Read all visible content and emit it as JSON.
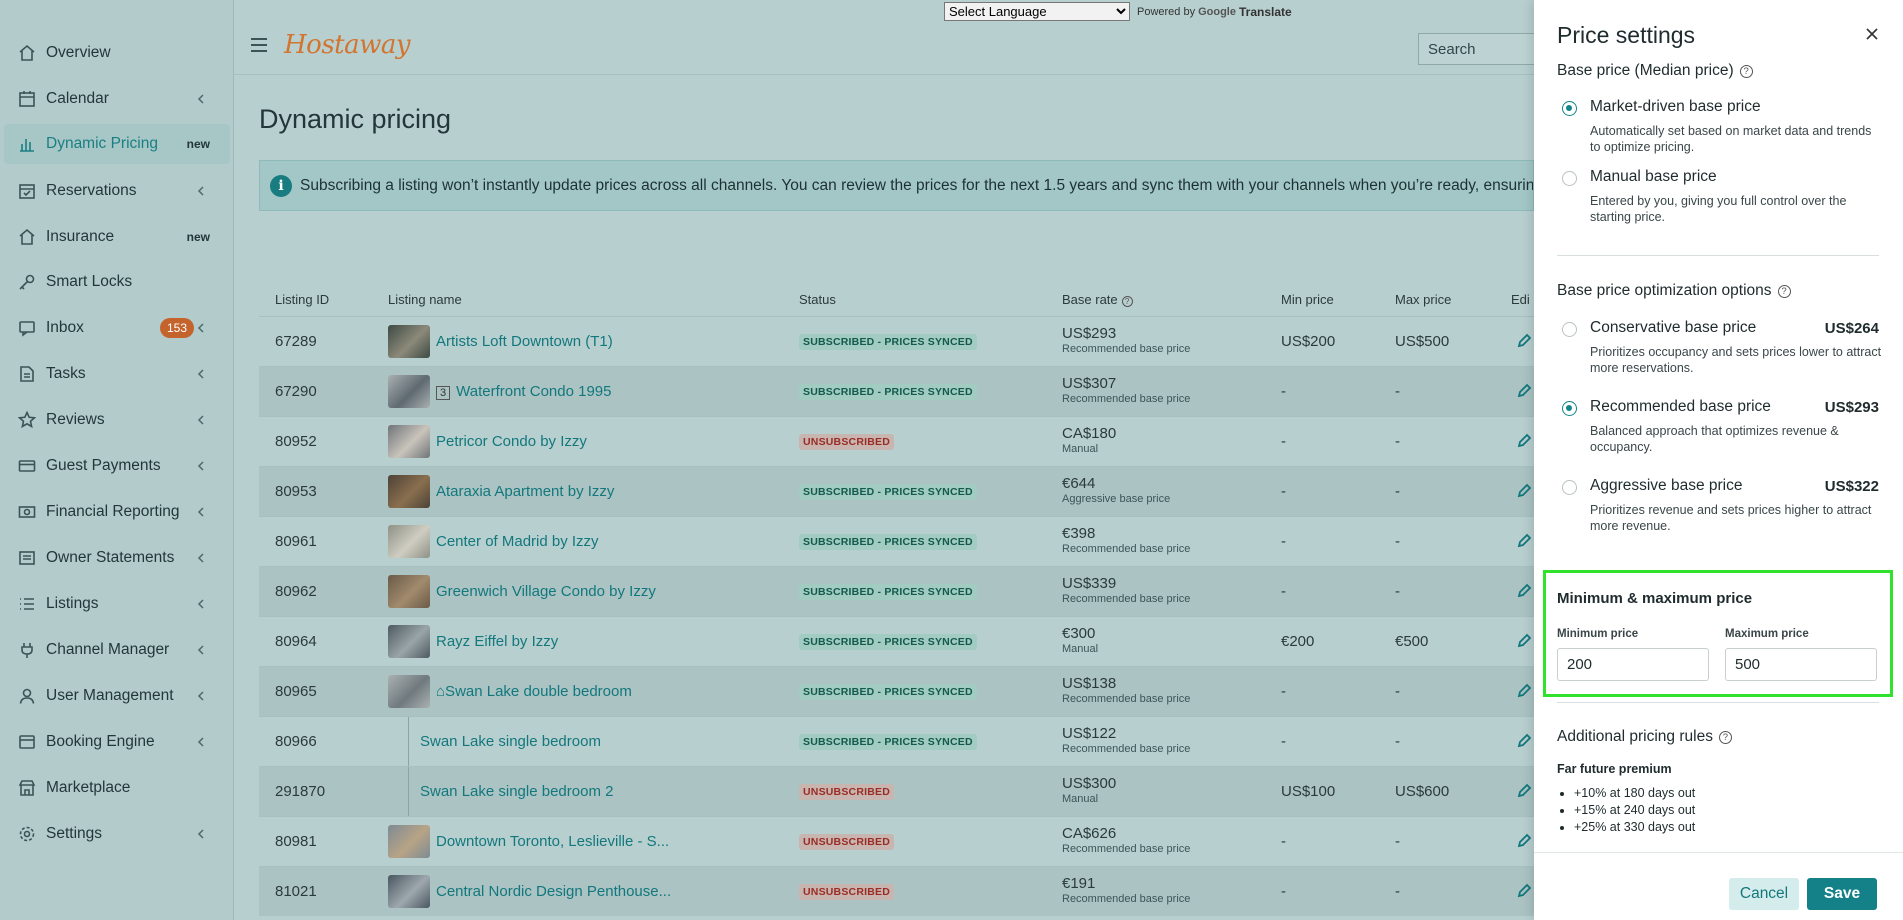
{
  "translate": {
    "select_value": "Select Language",
    "powered_by": "Powered by",
    "google": "Google",
    "translate": "Translate"
  },
  "header": {
    "logo": "Hostaway",
    "search_placeholder": "Search"
  },
  "sidebar": {
    "items": [
      {
        "label": "Overview",
        "icon": "home-icon"
      },
      {
        "label": "Calendar",
        "icon": "calendar-icon"
      },
      {
        "label": "Dynamic Pricing",
        "icon": "bar-chart-icon",
        "badge": "new"
      },
      {
        "label": "Reservations",
        "icon": "calendar-check-icon"
      },
      {
        "label": "Insurance",
        "icon": "home-shield-icon",
        "badge": "new"
      },
      {
        "label": "Smart Locks",
        "icon": "key-icon"
      },
      {
        "label": "Inbox",
        "icon": "chat-icon",
        "count": "153"
      },
      {
        "label": "Tasks",
        "icon": "tasks-icon"
      },
      {
        "label": "Reviews",
        "icon": "star-icon"
      },
      {
        "label": "Guest Payments",
        "icon": "credit-card-icon"
      },
      {
        "label": "Financial Reporting",
        "icon": "money-icon"
      },
      {
        "label": "Owner Statements",
        "icon": "statement-icon"
      },
      {
        "label": "Listings",
        "icon": "list-icon"
      },
      {
        "label": "Channel Manager",
        "icon": "plug-icon"
      },
      {
        "label": "User Management",
        "icon": "user-icon"
      },
      {
        "label": "Booking Engine",
        "icon": "globe-icon"
      },
      {
        "label": "Marketplace",
        "icon": "store-icon"
      },
      {
        "label": "Settings",
        "icon": "gear-icon"
      }
    ]
  },
  "main": {
    "title": "Dynamic pricing",
    "banner": "Subscribing a listing won’t instantly update prices across all channels. You can review the prices for the next 1.5 years and sync them with your channels when you’re ready, ensuring everythin",
    "columns": {
      "listing_id": "Listing ID",
      "listing_name": "Listing name",
      "status": "Status",
      "base_rate": "Base rate",
      "min_price": "Min price",
      "max_price": "Max price",
      "edit": "Edi"
    },
    "rows": [
      {
        "id": "67289",
        "name": "Artists Loft Downtown (T1)",
        "status": "SUBSCRIBED - PRICES SYNCED",
        "rate": "US$293",
        "rate_type": "Recommended base price",
        "min": "US$200",
        "max": "US$500"
      },
      {
        "id": "67290",
        "badge": "3",
        "name": "Waterfront Condo 1995",
        "status": "SUBSCRIBED - PRICES SYNCED",
        "rate": "US$307",
        "rate_type": "Recommended base price",
        "min": "-",
        "max": "-"
      },
      {
        "id": "80952",
        "name": "Petricor Condo by Izzy",
        "status": "UNSUBSCRIBED",
        "rate": "CA$180",
        "rate_type": "Manual",
        "min": "-",
        "max": "-"
      },
      {
        "id": "80953",
        "name": "Ataraxia Apartment by Izzy",
        "status": "SUBSCRIBED - PRICES SYNCED",
        "rate": "€644",
        "rate_type": "Aggressive base price",
        "min": "-",
        "max": "-"
      },
      {
        "id": "80961",
        "name": "Center of Madrid by Izzy",
        "status": "SUBSCRIBED - PRICES SYNCED",
        "rate": "€398",
        "rate_type": "Recommended base price",
        "min": "-",
        "max": "-"
      },
      {
        "id": "80962",
        "name": "Greenwich Village Condo by Izzy",
        "status": "SUBSCRIBED - PRICES SYNCED",
        "rate": "US$339",
        "rate_type": "Recommended base price",
        "min": "-",
        "max": "-"
      },
      {
        "id": "80964",
        "name": "Rayz Eiffel by Izzy",
        "status": "SUBSCRIBED - PRICES SYNCED",
        "rate": "€300",
        "rate_type": "Manual",
        "min": "€200",
        "max": "€500"
      },
      {
        "id": "80965",
        "name": "⌂Swan Lake double bedroom",
        "status": "SUBSCRIBED - PRICES SYNCED",
        "rate": "US$138",
        "rate_type": "Recommended base price",
        "min": "-",
        "max": "-"
      },
      {
        "id": "80966",
        "name": "Swan Lake single bedroom",
        "status": "SUBSCRIBED - PRICES SYNCED",
        "rate": "US$122",
        "rate_type": "Recommended base price",
        "min": "-",
        "max": "-"
      },
      {
        "id": "291870",
        "name": "Swan Lake single bedroom 2",
        "status": "UNSUBSCRIBED",
        "rate": "US$300",
        "rate_type": "Manual",
        "min": "US$100",
        "max": "US$600"
      },
      {
        "id": "80981",
        "name": "Downtown Toronto, Leslieville - S...",
        "status": "UNSUBSCRIBED",
        "rate": "CA$626",
        "rate_type": "Recommended base price",
        "min": "-",
        "max": "-"
      },
      {
        "id": "81021",
        "name": "Central Nordic Design Penthouse...",
        "status": "UNSUBSCRIBED",
        "rate": "€191",
        "rate_type": "Recommended base price",
        "min": "-",
        "max": "-"
      }
    ]
  },
  "drawer": {
    "title": "Price settings",
    "base_price_label": "Base price (Median price)",
    "market_driven": {
      "label": "Market-driven base price",
      "desc": "Automatically set based on market data and trends to optimize pricing.",
      "selected": true
    },
    "manual": {
      "label": "Manual base price",
      "desc": "Entered by you, giving you full control over the starting price.",
      "selected": false
    },
    "optimization_label": "Base price optimization options",
    "options": [
      {
        "label": "Conservative base price",
        "price": "US$264",
        "desc": "Prioritizes occupancy and sets prices lower to attract more reservations.",
        "selected": false
      },
      {
        "label": "Recommended base price",
        "price": "US$293",
        "desc": "Balanced approach that optimizes revenue & occupancy.",
        "selected": true
      },
      {
        "label": "Aggressive base price",
        "price": "US$322",
        "desc": "Prioritizes revenue and sets prices higher to attract more revenue.",
        "selected": false
      }
    ],
    "minmax": {
      "title": "Minimum & maximum price",
      "min_label": "Minimum price",
      "min_value": "200",
      "max_label": "Maximum price",
      "max_value": "500"
    },
    "rules": {
      "title": "Additional pricing rules",
      "subtitle": "Far future premium",
      "items": [
        "+10% at 180 days out",
        "+15% at 240 days out",
        "+25% at 330 days out"
      ]
    },
    "cancel_label": "Cancel",
    "save_label": "Save"
  }
}
